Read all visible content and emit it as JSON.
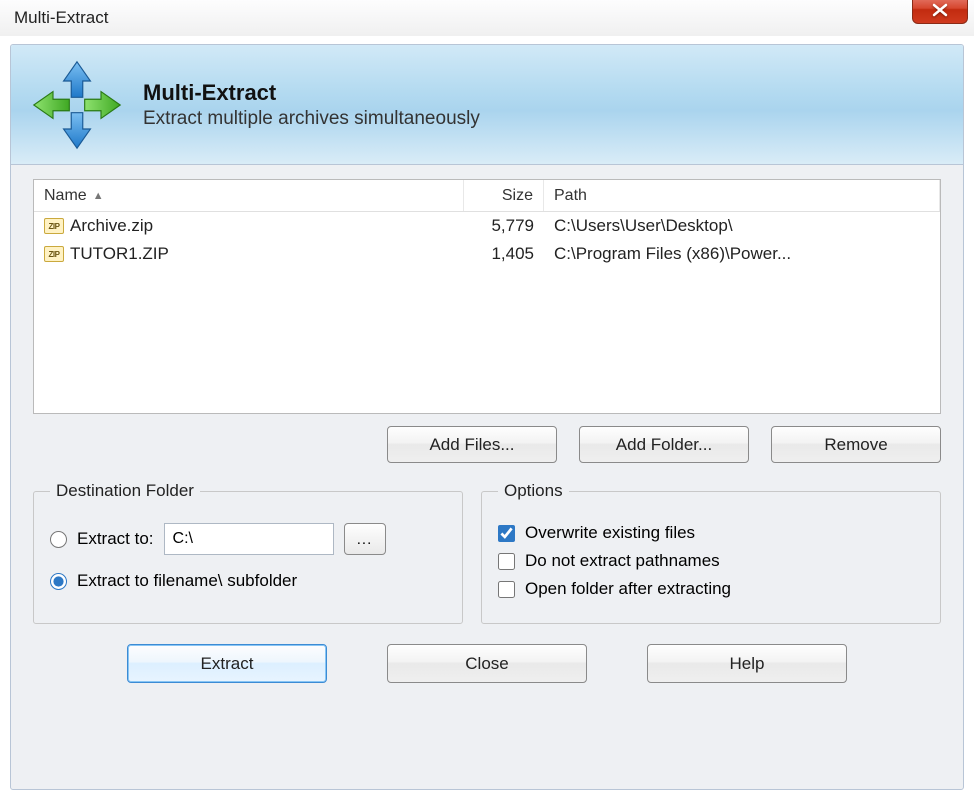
{
  "window": {
    "title": "Multi-Extract"
  },
  "banner": {
    "heading": "Multi-Extract",
    "sub": "Extract multiple archives simultaneously"
  },
  "list": {
    "columns": {
      "name": "Name",
      "size": "Size",
      "path": "Path"
    },
    "rows": [
      {
        "icon": "ZIP",
        "name": "Archive.zip",
        "size": "5,779",
        "path": "C:\\Users\\User\\Desktop\\"
      },
      {
        "icon": "ZIP",
        "name": "TUTOR1.ZIP",
        "size": "1,405",
        "path": "C:\\Program Files (x86)\\Power..."
      }
    ]
  },
  "buttons": {
    "add_files": "Add Files...",
    "add_folder": "Add Folder...",
    "remove": "Remove",
    "extract": "Extract",
    "close": "Close",
    "help": "Help",
    "browse": "..."
  },
  "destination": {
    "legend": "Destination Folder",
    "extract_to_label": "Extract to:",
    "path_value": "C:\\",
    "subfolder_label": "Extract to filename\\ subfolder"
  },
  "options": {
    "legend": "Options",
    "overwrite": "Overwrite existing files",
    "no_pathnames": "Do not extract pathnames",
    "open_after": "Open folder after extracting"
  }
}
